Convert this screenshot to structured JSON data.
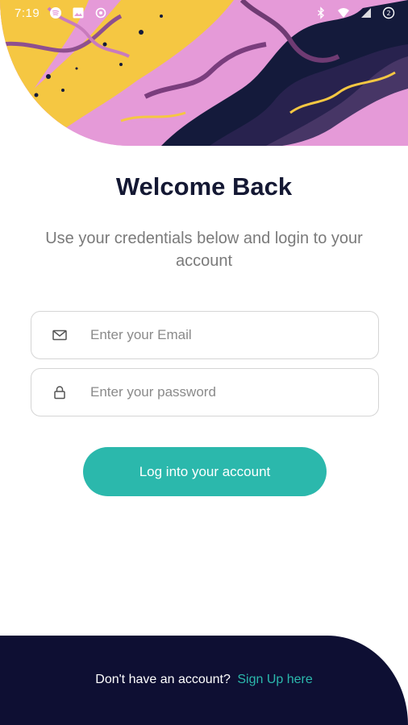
{
  "status_bar": {
    "time": "7:19",
    "left_icons": [
      "spotify-icon",
      "image-icon",
      "sync-icon"
    ],
    "right_icons": [
      "bluetooth-icon",
      "wifi-icon",
      "signal-icon",
      "battery-icon"
    ]
  },
  "hero": {
    "image": "abstract-marble-art",
    "colors": [
      "#e59ad8",
      "#f5c742",
      "#141a3b"
    ]
  },
  "header": {
    "title": "Welcome Back",
    "subtitle": "Use your credentials below and login to your account"
  },
  "form": {
    "email": {
      "icon": "mail-icon",
      "placeholder": "Enter your Email",
      "value": ""
    },
    "password": {
      "icon": "lock-icon",
      "placeholder": "Enter your password",
      "value": ""
    },
    "submit_label": "Log into your account"
  },
  "footer": {
    "prompt": "Don't have an account?",
    "link_label": "Sign Up here"
  },
  "colors": {
    "accent": "#2bb8ac",
    "navy": "#0e0f33",
    "title": "#141833",
    "muted": "#7a7a7a"
  }
}
